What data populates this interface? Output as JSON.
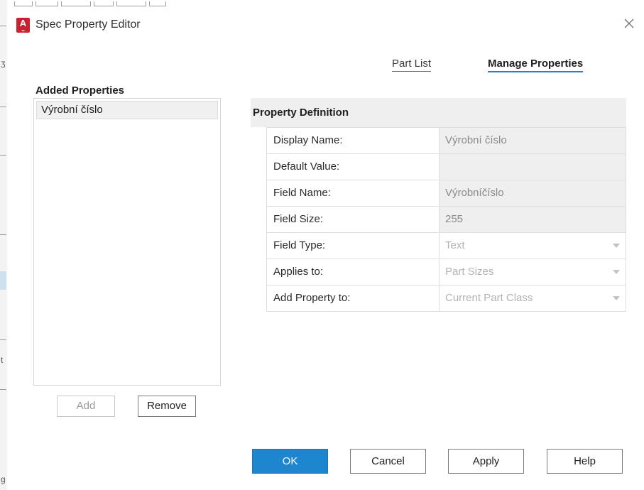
{
  "window": {
    "title": "Spec Property Editor",
    "icon": "autocad-app-icon",
    "icon_letter": "A"
  },
  "tabs": [
    {
      "label": "Part List",
      "active": false
    },
    {
      "label": "Manage Properties",
      "active": true
    }
  ],
  "added_properties": {
    "header": "Added Properties",
    "items": [
      "Výrobní číslo"
    ],
    "add_label": "Add",
    "remove_label": "Remove"
  },
  "property_definition": {
    "header": "Property Definition",
    "rows": [
      {
        "label": "Display Name:",
        "value": "Výrobní číslo",
        "type": "text"
      },
      {
        "label": "Default Value:",
        "value": "",
        "type": "text"
      },
      {
        "label": "Field Name:",
        "value": "Výrobníčíslo",
        "type": "text"
      },
      {
        "label": "Field Size:",
        "value": "255",
        "type": "text"
      },
      {
        "label": "Field Type:",
        "value": "Text",
        "type": "dropdown"
      },
      {
        "label": "Applies to:",
        "value": "Part Sizes",
        "type": "dropdown"
      },
      {
        "label": "Add Property to:",
        "value": "Current Part Class",
        "type": "dropdown"
      }
    ]
  },
  "footer": {
    "ok_label": "OK",
    "cancel_label": "Cancel",
    "apply_label": "Apply",
    "help_label": "Help"
  },
  "colors": {
    "accent": "#1e86cf",
    "tab_underline": "#1f86c4",
    "app_icon": "#c8212f"
  }
}
